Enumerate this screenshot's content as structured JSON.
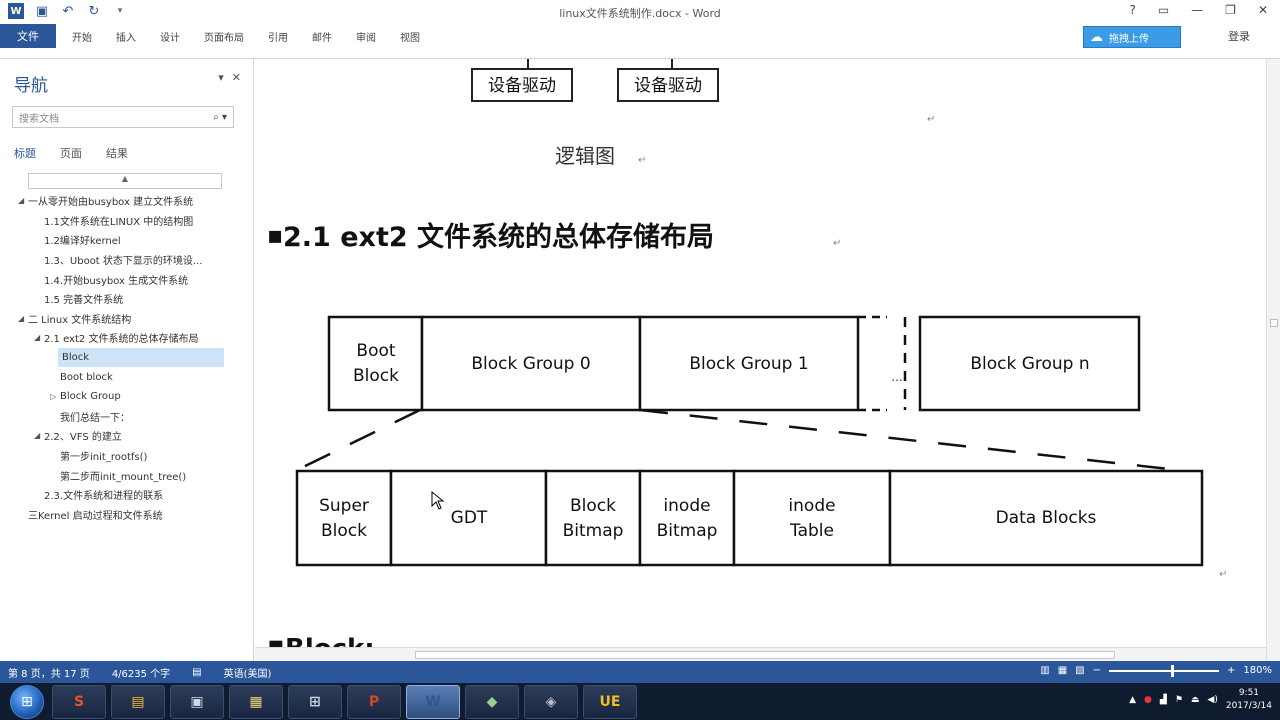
{
  "window": {
    "title": "linux文件系统制作.docx - Word",
    "controls": [
      "?",
      "▭",
      "—",
      "❐",
      "✕"
    ]
  },
  "qat": {
    "icons": [
      "word-logo-icon",
      "save-icon",
      "undo-icon",
      "redo-icon",
      "customize-icon"
    ]
  },
  "ribbon": {
    "file_tab": "文件",
    "tabs": [
      "开始",
      "插入",
      "设计",
      "页面布局",
      "引用",
      "邮件",
      "审阅",
      "视图"
    ],
    "cloud_button": "拖拽上传",
    "sign_in": "登录"
  },
  "nav": {
    "title": "导航",
    "search_placeholder": "搜索文档",
    "tabs": [
      "标题",
      "页面",
      "结果"
    ],
    "scroll_up": "▲",
    "items": [
      {
        "level": 0,
        "arrow": "◢",
        "text": "一从零开始由busybox 建立文件系统"
      },
      {
        "level": 1,
        "arrow": "",
        "text": "1.1文件系统在LINUX 中的结构图"
      },
      {
        "level": 1,
        "arrow": "",
        "text": "1.2编译好kernel"
      },
      {
        "level": 1,
        "arrow": "",
        "text": "1.3、Uboot 状态下显示的环境设..."
      },
      {
        "level": 1,
        "arrow": "",
        "text": "1.4.开始busybox 生成文件系统"
      },
      {
        "level": 1,
        "arrow": "",
        "text": "1.5 完善文件系统"
      },
      {
        "level": 0,
        "arrow": "◢",
        "text": "二 Linux 文件系统结构"
      },
      {
        "level": 1,
        "arrow": "◢",
        "text": "2.1 ext2 文件系统的总体存储布局"
      },
      {
        "level": 2,
        "arrow": "",
        "text": "Block",
        "selected": true
      },
      {
        "level": 2,
        "arrow": "",
        "text": "Boot block"
      },
      {
        "level": 2,
        "arrow": "▷",
        "text": "Block Group"
      },
      {
        "level": 2,
        "arrow": "",
        "text": "我们总结一下："
      },
      {
        "level": 1,
        "arrow": "◢",
        "text": "2.2、VFS 的建立"
      },
      {
        "level": 2,
        "arrow": "",
        "text": "第一步init_rootfs()"
      },
      {
        "level": 2,
        "arrow": "",
        "text": "第二步而init_mount_tree()"
      },
      {
        "level": 1,
        "arrow": "",
        "text": "2.3.文件系统和进程的联系"
      },
      {
        "level": 0,
        "arrow": "",
        "text": "三Kernel 启动过程和文件系统"
      }
    ]
  },
  "doc": {
    "driver_boxes": [
      "设备驱动",
      "设备驱动"
    ],
    "caption": "逻辑图",
    "heading_bullet": "▪",
    "heading": "2.1 ext2  文件系统的总体存储布局",
    "top_row": [
      "Boot Block",
      "Block Group 0",
      "Block Group 1",
      "...",
      "Block Group n"
    ],
    "bottom_row": [
      "Super Block",
      "GDT",
      "Block Bitmap",
      "inode Bitmap",
      "inode Table",
      "Data Blocks"
    ],
    "next_heading": "Block:",
    "para_mark": "↵"
  },
  "status": {
    "page": "第 8 页，共 17 页",
    "words": "4/6235 个字",
    "lang": "英语(美国)",
    "zoom": "180%",
    "zoom_fraction": 0.56
  },
  "taskbar": {
    "apps": [
      {
        "name": "taskbar-app-sogou",
        "glyph": "S",
        "color": "#e8532a"
      },
      {
        "name": "taskbar-app-explorer-folder",
        "glyph": "▤",
        "color": "#f0c030"
      },
      {
        "name": "taskbar-app-video",
        "glyph": "▣",
        "color": "#cfd8e8"
      },
      {
        "name": "taskbar-app-file-manager",
        "glyph": "▦",
        "color": "#f2d27a"
      },
      {
        "name": "taskbar-app-network",
        "glyph": "⊞",
        "color": "#cfd8e8"
      },
      {
        "name": "taskbar-app-powerpoint",
        "glyph": "P",
        "color": "#d24726"
      },
      {
        "name": "taskbar-app-word",
        "glyph": "W",
        "color": "#2b579a",
        "active": true
      },
      {
        "name": "taskbar-app-vm",
        "glyph": "◆",
        "color": "#9fd08a"
      },
      {
        "name": "taskbar-app-vmware",
        "glyph": "◈",
        "color": "#c0c0c0"
      },
      {
        "name": "taskbar-app-ultraedit",
        "glyph": "UE",
        "color": "#f0c020"
      }
    ],
    "time": "9:51",
    "date": "2017/3/14"
  },
  "colors": {
    "accent": "#2b579a",
    "taskbar": "#0f1b2f"
  }
}
